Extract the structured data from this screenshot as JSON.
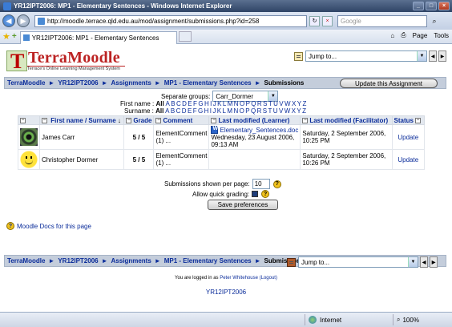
{
  "browser": {
    "title": "YR12IPT2006: MP1 - Elementary Sentences - Windows Internet Explorer",
    "url": "http://moodle.terrace.qld.edu.au/mod/assignment/submissions.php?id=258",
    "search_placeholder": "Google",
    "tab_title": "YR12IPT2006: MP1 - Elementary Sentences",
    "page_menu": "Page",
    "tools_menu": "Tools",
    "status_zone": "Internet",
    "zoom": "100%"
  },
  "site": {
    "logo_text": "TerraMoodle",
    "logo_sub": "Terrace's Online Learning Management System",
    "jump_placeholder": "Jump to..."
  },
  "breadcrumb": {
    "items": [
      "TerraMoodle",
      "YR12IPT2006",
      "Assignments",
      "MP1 - Elementary Sentences"
    ],
    "current": "Submissions",
    "separator": "►",
    "update_button": "Update this Assignment"
  },
  "filters": {
    "groups_label": "Separate groups:",
    "groups_value": "Carr_Dormer",
    "firstname_label": "First name :",
    "surname_label": "Surname :",
    "all_label": "All",
    "letters": [
      "A",
      "B",
      "C",
      "D",
      "E",
      "F",
      "G",
      "H",
      "I",
      "J",
      "K",
      "L",
      "M",
      "N",
      "O",
      "P",
      "Q",
      "R",
      "S",
      "T",
      "U",
      "V",
      "W",
      "X",
      "Y",
      "Z"
    ]
  },
  "table": {
    "headers": {
      "first_name": "First name",
      "slash": "/",
      "surname": "Surname",
      "sort_arrow": "↓",
      "grade": "Grade",
      "comment": "Comment",
      "last_modified_learner": "Last modified (Learner)",
      "last_modified_facilitator": "Last modified (Facilitator)",
      "status": "Status"
    },
    "rows": [
      {
        "name": "James Carr",
        "grade": "5 / 5",
        "comment": "ElementComment (1) ...",
        "file": "Elementary_Sentences.doc",
        "learner_modified": "Wednesday, 23 August 2006, 09:13 AM",
        "facilitator_modified": "Saturday, 2 September 2006, 10:25 PM",
        "status": "Update"
      },
      {
        "name": "Christopher Dormer",
        "grade": "5 / 5",
        "comment": "ElementComment (1) ...",
        "file": "",
        "learner_modified": "",
        "facilitator_modified": "Saturday, 2 September 2006, 10:26 PM",
        "status": "Update"
      }
    ]
  },
  "prefs": {
    "per_page_label": "Submissions shown per page:",
    "per_page_value": "10",
    "quick_grading_label": "Allow quick grading:",
    "save_button": "Save preferences",
    "help_glyph": "?"
  },
  "footer": {
    "docs_link": "Moodle Docs for this page",
    "logged_in_prefix": "You are logged in as",
    "user": "Peter Whitehouse",
    "logout": "(Logout)",
    "home_link": "YR12IPT2006"
  }
}
